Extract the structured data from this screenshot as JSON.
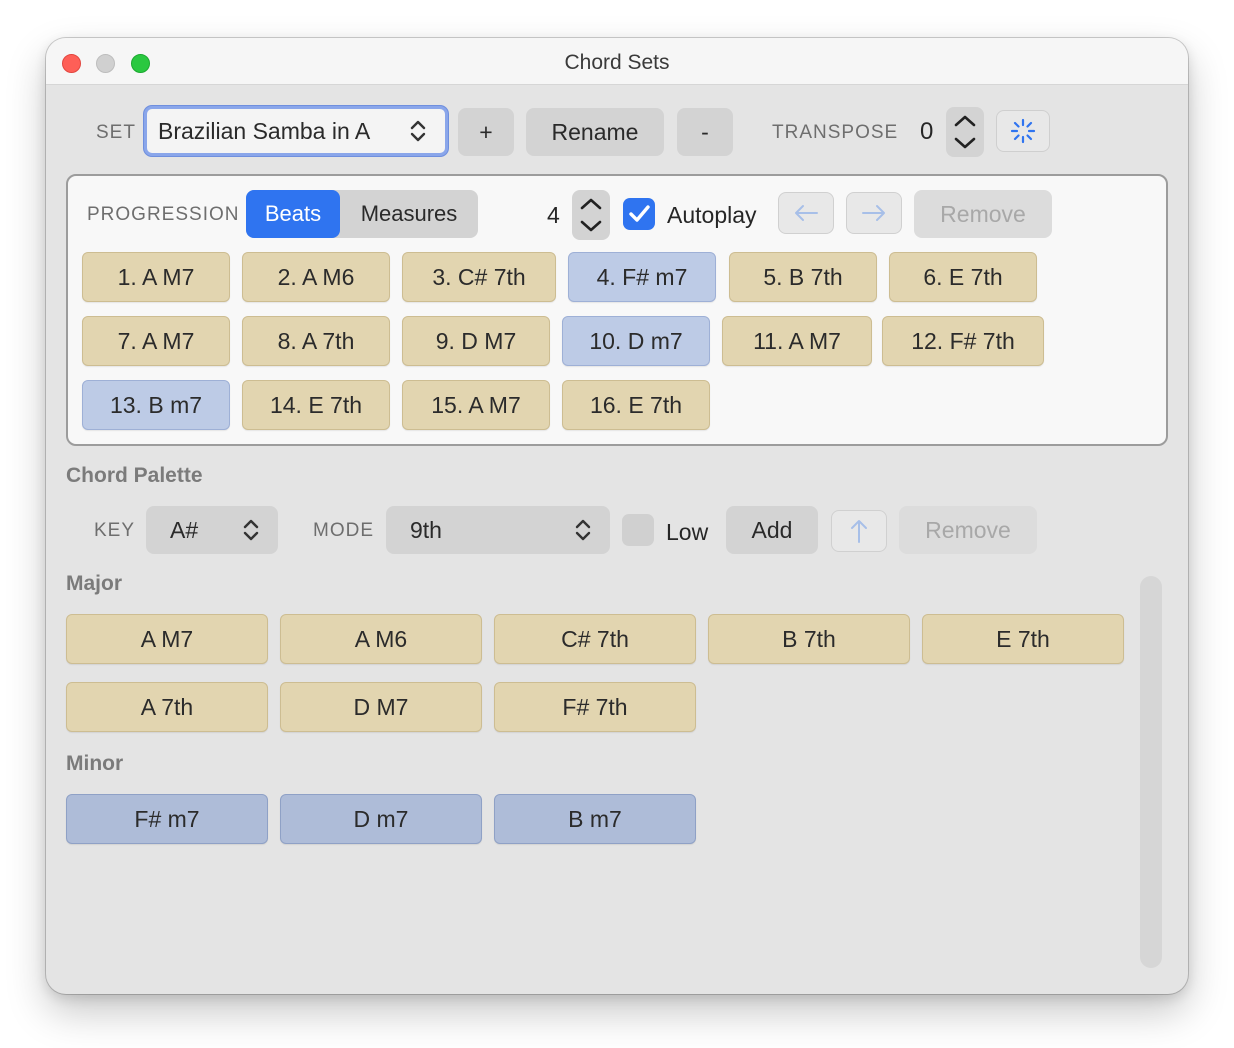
{
  "window": {
    "title": "Chord Sets"
  },
  "toolbar": {
    "set_label": "SET",
    "set_value": "Brazilian Samba in A",
    "add_label": "+",
    "rename_label": "Rename",
    "remove_label": "-",
    "transpose_label": "TRANSPOSE",
    "transpose_value": "0"
  },
  "progression": {
    "label": "PROGRESSION",
    "segments": [
      "Beats",
      "Measures"
    ],
    "selected_segment": "Beats",
    "count": "4",
    "autoplay_label": "Autoplay",
    "autoplay_checked": true,
    "remove_label": "Remove",
    "chords": [
      {
        "label": "1. A M7",
        "kind": "major"
      },
      {
        "label": "2. A M6",
        "kind": "major"
      },
      {
        "label": "3. C# 7th",
        "kind": "major"
      },
      {
        "label": "4. F# m7",
        "kind": "minor"
      },
      {
        "label": "5. B 7th",
        "kind": "major"
      },
      {
        "label": "6. E 7th",
        "kind": "major"
      },
      {
        "label": "7. A M7",
        "kind": "major"
      },
      {
        "label": "8. A 7th",
        "kind": "major"
      },
      {
        "label": "9. D M7",
        "kind": "major"
      },
      {
        "label": "10. D m7",
        "kind": "minor"
      },
      {
        "label": "11. A M7",
        "kind": "major"
      },
      {
        "label": "12. F# 7th",
        "kind": "major"
      },
      {
        "label": "13. B m7",
        "kind": "minor"
      },
      {
        "label": "14. E 7th",
        "kind": "major"
      },
      {
        "label": "15. A M7",
        "kind": "major"
      },
      {
        "label": "16. E 7th",
        "kind": "major"
      }
    ]
  },
  "palette": {
    "title": "Chord Palette",
    "key_label": "KEY",
    "key_value": "A#",
    "mode_label": "MODE",
    "mode_value": "9th",
    "low_label": "Low",
    "low_checked": false,
    "add_label": "Add",
    "remove_label": "Remove",
    "major_title": "Major",
    "major": [
      "A M7",
      "A M6",
      "C# 7th",
      "B 7th",
      "E 7th",
      "A 7th",
      "D M7",
      "F# 7th"
    ],
    "minor_title": "Minor",
    "minor": [
      "F# m7",
      "D m7",
      "B m7"
    ]
  },
  "colors": {
    "accent": "#2f74f0",
    "major_chord": "#e2d5b0",
    "minor_chord": "#bdcbe6"
  }
}
